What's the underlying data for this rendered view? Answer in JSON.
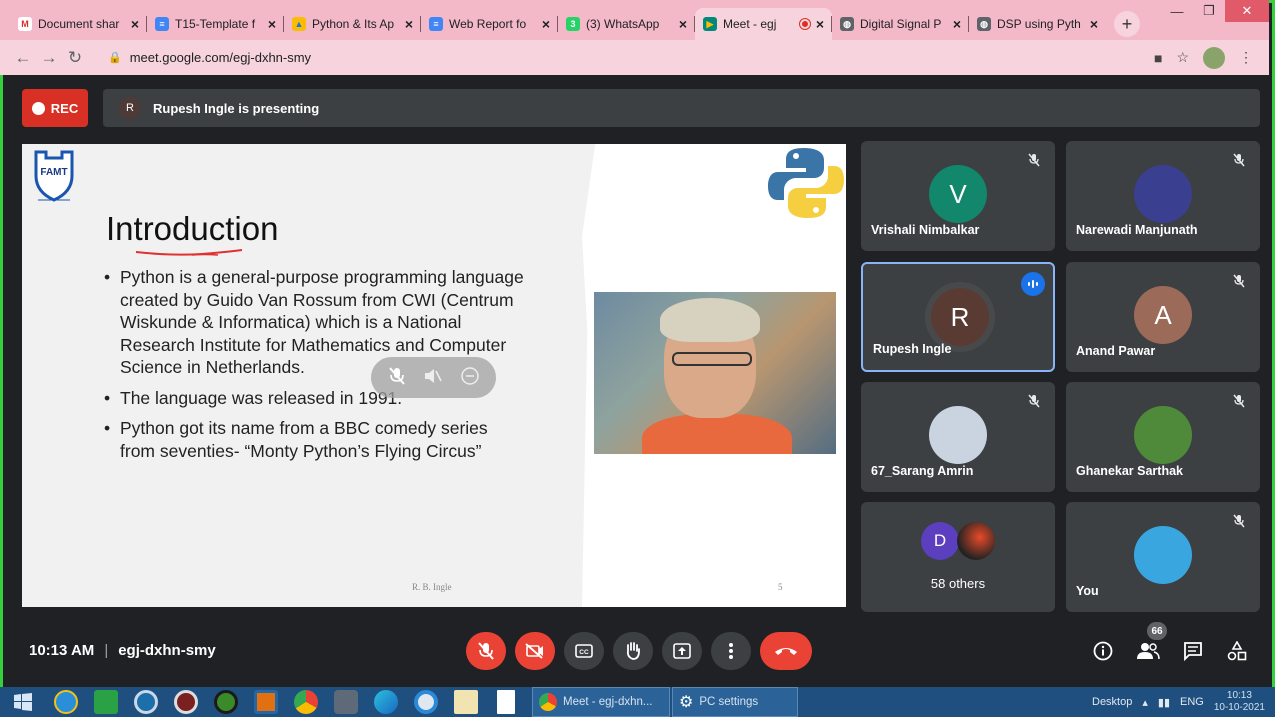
{
  "browser": {
    "tabs": [
      {
        "title": "Document shar",
        "favicon": "gmail-icon",
        "color": "#ffffff",
        "glyph": "M",
        "glyph_color": "#d93025"
      },
      {
        "title": "T15-Template f",
        "favicon": "docs-icon",
        "color": "#4285f4",
        "glyph": "≡",
        "glyph_color": "#ffffff"
      },
      {
        "title": "Python & Its Ap",
        "favicon": "drive-icon",
        "color": "#fbbc04",
        "glyph": "▲",
        "glyph_color": "#1a73e8"
      },
      {
        "title": "Web Report fo",
        "favicon": "docs-icon",
        "color": "#4285f4",
        "glyph": "≡",
        "glyph_color": "#ffffff"
      },
      {
        "title": "(3) WhatsApp",
        "favicon": "whatsapp-icon",
        "color": "#25d366",
        "glyph": "3",
        "glyph_color": "#ffffff"
      },
      {
        "title": "Meet - egj",
        "favicon": "meet-icon",
        "color": "#00897b",
        "glyph": "▶",
        "glyph_color": "#fbbc04",
        "active": true
      },
      {
        "title": "Digital Signal P",
        "favicon": "globe-icon",
        "color": "#5f6368",
        "glyph": "◍",
        "glyph_color": "#ffffff"
      },
      {
        "title": "DSP using Pyth",
        "favicon": "globe-icon",
        "color": "#5f6368",
        "glyph": "◍",
        "glyph_color": "#ffffff"
      }
    ],
    "url": "meet.google.com/egj-dxhn-smy"
  },
  "meet": {
    "rec_label": "REC",
    "presenter_initial": "R",
    "presenting_text": "Rupesh Ingle is presenting",
    "meeting_time": "10:13 AM",
    "meeting_code": "egj-dxhn-smy",
    "participant_count": "66"
  },
  "slide": {
    "logo_text": "FAMT",
    "heading": "Introduction",
    "bullets": [
      "Python is a general-purpose programming language created by Guido  Van Rossum from CWI (Centrum Wiskunde & Informatica) which is a National Research Institute for Mathematics and Computer Science in Netherlands.",
      "The language was released in 1991.",
      "Python got its name from a BBC comedy series from seventies- “Monty Python’s Flying Circus”"
    ],
    "footer_author": "R. B. Ingle",
    "page_number": "5"
  },
  "participants": [
    {
      "name": "Vrishali Nimbalkar",
      "initial": "V",
      "avatar_color": "#12876b",
      "muted": true
    },
    {
      "name": "Narewadi Manjunath",
      "initial": "",
      "avatar_color": "#3a3f8f",
      "muted": true
    },
    {
      "name": "Rupesh Ingle",
      "initial": "R",
      "avatar_color": "#5a3b34",
      "speaking": true
    },
    {
      "name": "Anand Pawar",
      "initial": "A",
      "avatar_color": "#9b6a58",
      "muted": true
    },
    {
      "name": "67_Sarang Amrin",
      "initial": "",
      "avatar_color": "#c9d4e0",
      "muted": true
    },
    {
      "name": "Ghanekar Sarthak",
      "initial": "",
      "avatar_color": "#4f8a3a",
      "muted": true
    },
    {
      "name": "58 others",
      "initial": "D",
      "avatar_color": "#5b3fbf"
    },
    {
      "name": "You",
      "initial": "",
      "avatar_color": "#3aa6e0",
      "muted": true
    }
  ],
  "taskbar": {
    "windows": [
      {
        "label": "Meet - egj-dxhn..."
      },
      {
        "label": "PC settings"
      }
    ],
    "desktop_label": "Desktop",
    "language": "ENG",
    "time": "10:13",
    "date": "10-10-2021"
  }
}
